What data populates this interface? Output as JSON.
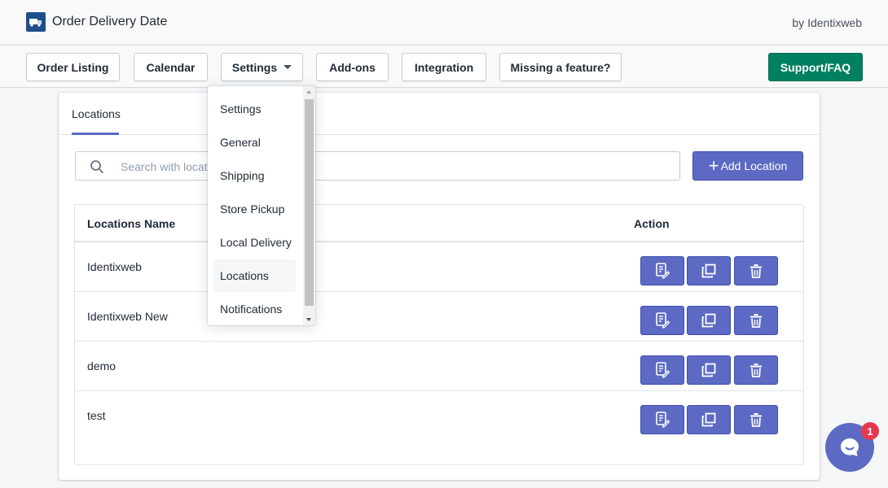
{
  "header": {
    "app_title": "Order Delivery Date",
    "by_line": "by Identixweb",
    "logo_icon": "truck-icon"
  },
  "nav": {
    "order_listing": "Order Listing",
    "calendar": "Calendar",
    "settings": "Settings",
    "add_ons": "Add-ons",
    "integration": "Integration",
    "missing_feature": "Missing a feature?",
    "support": "Support/FAQ"
  },
  "settings_menu": {
    "items": [
      "Settings",
      "General",
      "Shipping",
      "Store Pickup",
      "Local Delivery",
      "Locations",
      "Notifications"
    ],
    "selected": "Locations"
  },
  "tabs": {
    "active": "Locations"
  },
  "search": {
    "placeholder": "Search with location name",
    "value": ""
  },
  "add_location": {
    "label": "Add Location"
  },
  "table": {
    "headers": {
      "name": "Locations Name",
      "action": "Action"
    },
    "rows": [
      {
        "name": "Identixweb"
      },
      {
        "name": "Identixweb New"
      },
      {
        "name": "demo"
      },
      {
        "name": "test"
      }
    ],
    "action_icons": [
      "edit-icon",
      "duplicate-icon",
      "delete-icon"
    ]
  },
  "chat": {
    "badge_count": "1"
  },
  "colors": {
    "accent": "#5c6ac4",
    "support": "#008060",
    "badge": "#e8384f"
  }
}
